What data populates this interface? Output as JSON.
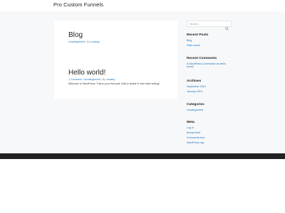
{
  "header": {
    "site_title": "Pro Custom Funnels"
  },
  "posts": [
    {
      "title": "Blog",
      "meta": {
        "category": "Uncategorized",
        "separator": " / By ",
        "author": "crossby"
      },
      "excerpt": ""
    },
    {
      "title": "Hello world!",
      "meta": {
        "comments": "1 Comment",
        "sep1": " / ",
        "category": "Uncategorized",
        "separator": " / By ",
        "author": "crossby"
      },
      "excerpt": "Welcome to WordPress. This is your first post. Edit or delete it, then start writing!"
    }
  ],
  "sidebar": {
    "search": {
      "placeholder": "Search ...",
      "icon": "search-icon"
    },
    "recent_posts": {
      "title": "Recent Posts",
      "items": [
        "Blog",
        "Hello world!"
      ]
    },
    "recent_comments": {
      "title": "Recent Comments",
      "author": "A WordPress Commenter",
      "connector": " on ",
      "post": "Hello world!"
    },
    "archives": {
      "title": "Archives",
      "items": [
        "September 2019",
        "January 2019"
      ]
    },
    "categories": {
      "title": "Categories",
      "items": [
        "Uncategorized"
      ]
    },
    "meta": {
      "title": "Meta",
      "items": [
        "Log in",
        "Entries feed",
        "Comments feed",
        "WordPress.org"
      ]
    }
  },
  "colors": {
    "link": "#1e73be",
    "background": "#f7f8f9",
    "footer": "#222222"
  }
}
